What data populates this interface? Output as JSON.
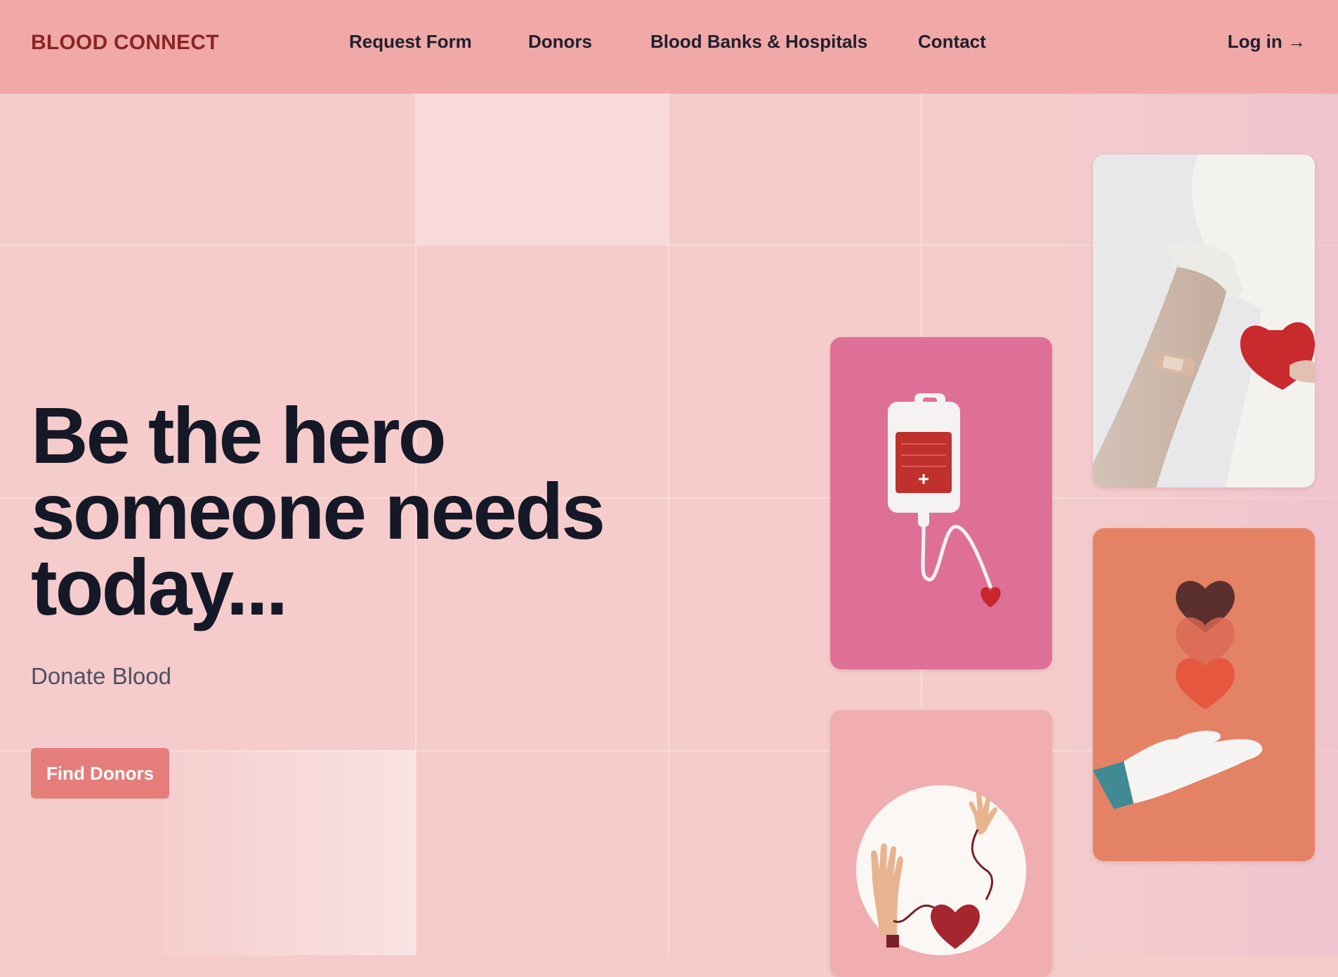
{
  "brand": "BLOOD CONNECT",
  "nav": {
    "items": [
      "Request Form",
      "Donors",
      "Blood Banks & Hospitals",
      "Contact"
    ],
    "login_label": "Log in",
    "login_arrow": "→"
  },
  "hero": {
    "headline_lines": [
      "Be the hero",
      "someone needs",
      "today..."
    ],
    "subtitle": "Donate Blood",
    "cta_label": "Find Donors"
  },
  "images": [
    {
      "name": "blood-bag-illustration",
      "bg": "#de7098"
    },
    {
      "name": "arm-with-heart-photo",
      "bg": "#e8e8ea"
    },
    {
      "name": "hand-giving-hearts-illustration",
      "bg": "#e48266"
    },
    {
      "name": "hands-transfusion-heart-illustration",
      "bg": "#f0aeb0"
    }
  ],
  "colors": {
    "header_bg": "#f1a9a7",
    "page_bg": "#f5cccb",
    "brand": "#8c2424",
    "cta_bg": "#e57d7b",
    "headline": "#141827"
  }
}
